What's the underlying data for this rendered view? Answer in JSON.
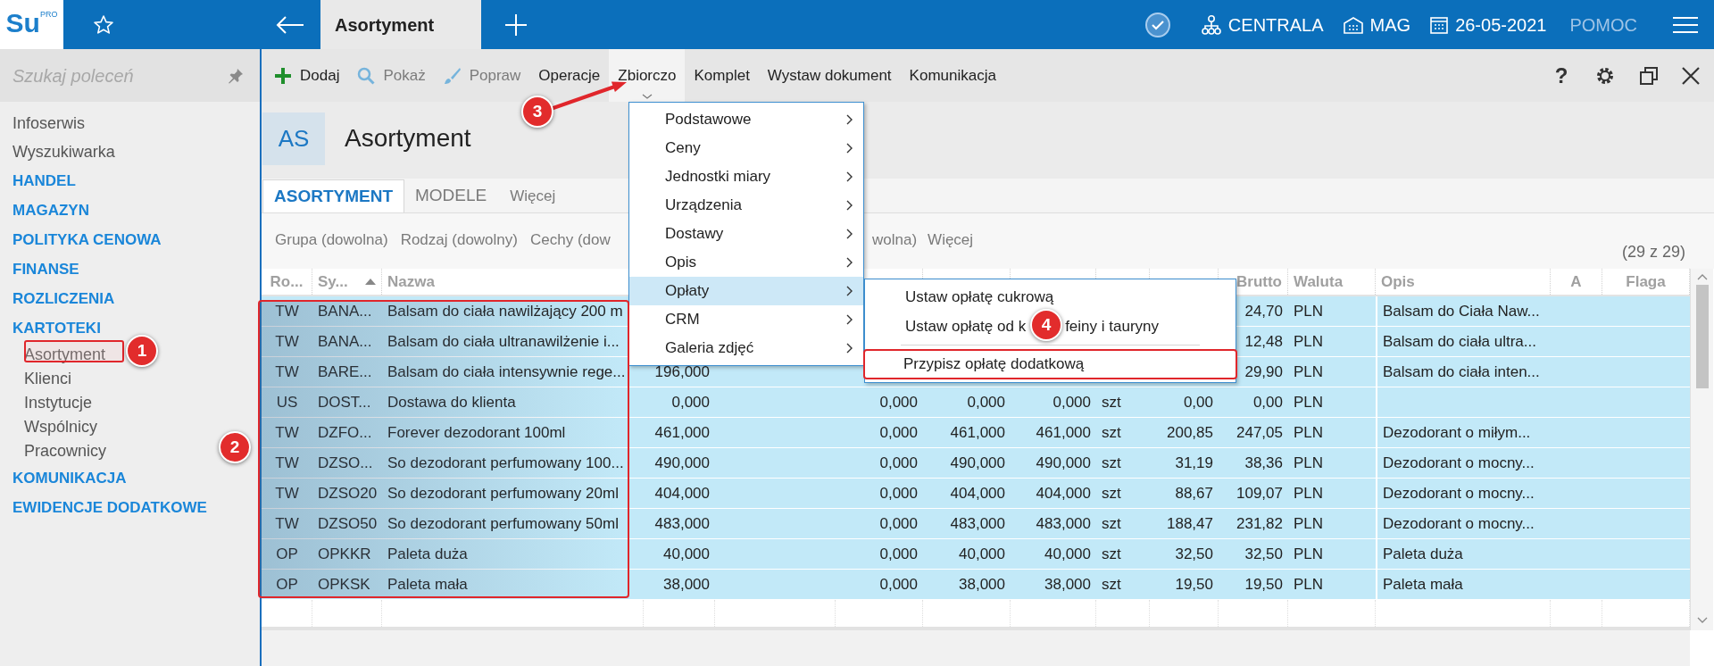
{
  "app": {
    "logo": "Su",
    "logo_badge": "PRO"
  },
  "top_bar": {
    "tab": "Asortyment",
    "company": "CENTRALA",
    "warehouse": "MAG",
    "date": "26-05-2021",
    "help": "POMOC"
  },
  "sidebar": {
    "search": {
      "placeholder": "Szukaj poleceń"
    },
    "items": [
      {
        "label": "Infoserwis",
        "kind": "link"
      },
      {
        "label": "Wyszukiwarka",
        "kind": "link"
      },
      {
        "label": "HANDEL",
        "kind": "section"
      },
      {
        "label": "MAGAZYN",
        "kind": "section"
      },
      {
        "label": "POLITYKA CENOWA",
        "kind": "section"
      },
      {
        "label": "FINANSE",
        "kind": "section"
      },
      {
        "label": "ROZLICZENIA",
        "kind": "section"
      },
      {
        "label": "KARTOTEKI",
        "kind": "section",
        "children": [
          {
            "label": "Asortyment",
            "kind": "link"
          },
          {
            "label": "Klienci",
            "kind": "link"
          },
          {
            "label": "Instytucje",
            "kind": "link"
          },
          {
            "label": "Wspólnicy",
            "kind": "link"
          },
          {
            "label": "Pracownicy",
            "kind": "link"
          }
        ]
      },
      {
        "label": "KOMUNIKACJA",
        "kind": "section"
      },
      {
        "label": "EWIDENCJE DODATKOWE",
        "kind": "section"
      }
    ]
  },
  "toolbar": {
    "items": [
      {
        "label": "Dodaj",
        "disabled": false,
        "expanded": false
      },
      {
        "label": "Pokaż",
        "disabled": true,
        "expanded": false
      },
      {
        "label": "Popraw",
        "disabled": true,
        "expanded": false
      },
      {
        "label": "Operacje",
        "disabled": false,
        "expanded": false
      },
      {
        "label": "Zbiorczo",
        "disabled": false,
        "expanded": true
      },
      {
        "label": "Komplet",
        "disabled": false,
        "expanded": false
      },
      {
        "label": "Wystaw dokument",
        "disabled": false,
        "expanded": false
      },
      {
        "label": "Komunikacja",
        "disabled": false,
        "expanded": false
      }
    ],
    "help": "?"
  },
  "header": {
    "badge": "AS",
    "title": "Asortyment"
  },
  "tabs": [
    {
      "label": "ASORTYMENT",
      "kind": "tab",
      "selected": true
    },
    {
      "label": "MODELE",
      "kind": "tab",
      "selected": false
    },
    {
      "label": "Więcej",
      "kind": "more",
      "selected": false
    }
  ],
  "filters": [
    {
      "label": "Grupa (dowolna)"
    },
    {
      "label": "Rodzaj (dowolny)"
    },
    {
      "label": "Cechy (dow"
    },
    {
      "label": "wolna)"
    },
    {
      "label": "Więcej"
    }
  ],
  "count": "(29 z 29)",
  "table": {
    "columns": [
      {
        "label": "Ro...",
        "sorted": false
      },
      {
        "label": "Sy...",
        "sorted": true
      },
      {
        "label": "Nazwa",
        "sorted": false
      },
      {},
      {},
      {},
      {},
      {},
      {},
      {},
      {
        "label": "Brutto",
        "sorted": false
      },
      {
        "label": "Waluta",
        "sorted": false
      },
      {
        "label": "Opis",
        "sorted": false
      },
      {
        "label": "A",
        "sorted": false
      },
      {
        "label": "Flaga",
        "sorted": false
      }
    ],
    "rows": [
      {
        "selected": true,
        "cells": [
          "TW",
          "BANA...",
          "Balsam do ciała nawilżający 200 m",
          null,
          null,
          null,
          null,
          null,
          null,
          null,
          "24,70",
          "PLN",
          "Balsam do Ciała Naw...",
          null,
          null
        ]
      },
      {
        "selected": true,
        "cells": [
          "TW",
          "BANA...",
          "Balsam do ciała ultranawilżenie i...",
          null,
          null,
          null,
          null,
          null,
          null,
          null,
          "12,48",
          "PLN",
          "Balsam do ciała ultra...",
          null,
          null
        ]
      },
      {
        "selected": true,
        "cells": [
          "TW",
          "BARE...",
          "Balsam do ciała intensywnie rege...",
          "196,000",
          null,
          null,
          null,
          null,
          null,
          null,
          "29,90",
          "PLN",
          "Balsam do ciała inten...",
          null,
          null
        ]
      },
      {
        "selected": true,
        "cells": [
          "US",
          "DOST...",
          "Dostawa do klienta",
          "0,000",
          null,
          "0,000",
          "0,000",
          "0,000",
          "szt",
          "0,00",
          "0,00",
          "PLN",
          null,
          null,
          null
        ]
      },
      {
        "selected": true,
        "cells": [
          "TW",
          "DZFO...",
          "Forever dezodorant 100ml",
          "461,000",
          null,
          "0,000",
          "461,000",
          "461,000",
          "szt",
          "200,85",
          "247,05",
          "PLN",
          "Dezodorant o miłym...",
          null,
          null
        ]
      },
      {
        "selected": true,
        "cells": [
          "TW",
          "DZSO...",
          "So dezodorant perfumowany 100...",
          "490,000",
          null,
          "0,000",
          "490,000",
          "490,000",
          "szt",
          "31,19",
          "38,36",
          "PLN",
          "Dezodorant o mocny...",
          null,
          null
        ]
      },
      {
        "selected": true,
        "cells": [
          "TW",
          "DZSO20",
          "So dezodorant perfumowany 20ml",
          "404,000",
          null,
          "0,000",
          "404,000",
          "404,000",
          "szt",
          "88,67",
          "109,07",
          "PLN",
          "Dezodorant o mocny...",
          null,
          null
        ]
      },
      {
        "selected": true,
        "cells": [
          "TW",
          "DZSO50",
          "So dezodorant perfumowany 50ml",
          "483,000",
          null,
          "0,000",
          "483,000",
          "483,000",
          "szt",
          "188,47",
          "231,82",
          "PLN",
          "Dezodorant o mocny...",
          null,
          null
        ]
      },
      {
        "selected": true,
        "cells": [
          "OP",
          "OPKKR",
          "Paleta duża",
          "40,000",
          null,
          "0,000",
          "40,000",
          "40,000",
          "szt",
          "32,50",
          "32,50",
          "PLN",
          "Paleta duża",
          null,
          null
        ]
      },
      {
        "selected": true,
        "cells": [
          "OP",
          "OPKSK",
          "Paleta mała",
          "38,000",
          null,
          "0,000",
          "38,000",
          "38,000",
          "szt",
          "19,50",
          "19,50",
          "PLN",
          "Paleta mała",
          null,
          null
        ]
      }
    ]
  },
  "menu": {
    "items": [
      {
        "label": "Podstawowe",
        "selected": false
      },
      {
        "label": "Ceny",
        "selected": false
      },
      {
        "label": "Jednostki miary",
        "selected": false
      },
      {
        "label": "Urządzenia",
        "selected": false
      },
      {
        "label": "Dostawy",
        "selected": false
      },
      {
        "label": "Opis",
        "selected": false
      },
      {
        "label": "Opłaty",
        "selected": true
      },
      {
        "label": "CRM",
        "selected": false
      },
      {
        "label": "Galeria zdjęć",
        "selected": false
      }
    ],
    "submenu": [
      {
        "kind": "item",
        "label": "Ustaw opłatę cukrową",
        "outlined": false
      },
      {
        "kind": "item",
        "label": "Ustaw opłatę od k",
        "label_after_callout": "feiny i tauryny",
        "outlined": false
      },
      {
        "kind": "separator"
      },
      {
        "kind": "item",
        "label": "Przypisz opłatę dodatkową",
        "outlined": true
      }
    ]
  },
  "annotations": [
    "1",
    "2",
    "3",
    "4"
  ]
}
